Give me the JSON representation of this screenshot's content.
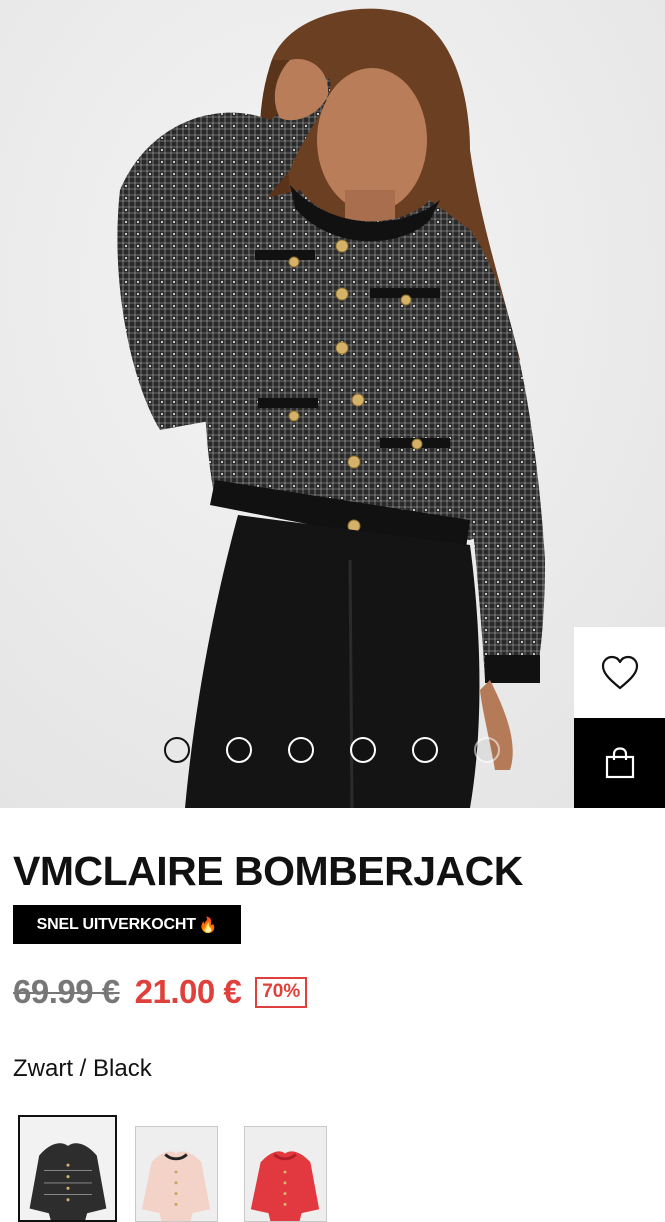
{
  "gallery": {
    "image_alt": "Model wearing VMCLAIRE bomber jacket in black tweed",
    "slide_count": 6,
    "active_slide": 1,
    "wishlist_icon": "heart-icon",
    "cart_icon": "shopping-bag-icon"
  },
  "product": {
    "title": "VMCLAIRE BOMBERJACK",
    "badge": "SNEL UITVERKOCHT",
    "badge_icon": "🔥",
    "old_price": "69.99 €",
    "new_price": "21.00 €",
    "discount": "70%",
    "color_label": "Zwart / Black"
  },
  "colors": {
    "accent_red": "#e0403b",
    "black": "#000000",
    "swatches": [
      {
        "name": "black-tweed",
        "hex": "#2d2d2d",
        "selected": true
      },
      {
        "name": "pink",
        "hex": "#f3d3c8",
        "selected": false
      },
      {
        "name": "red",
        "hex": "#e2383f",
        "selected": false
      }
    ]
  }
}
